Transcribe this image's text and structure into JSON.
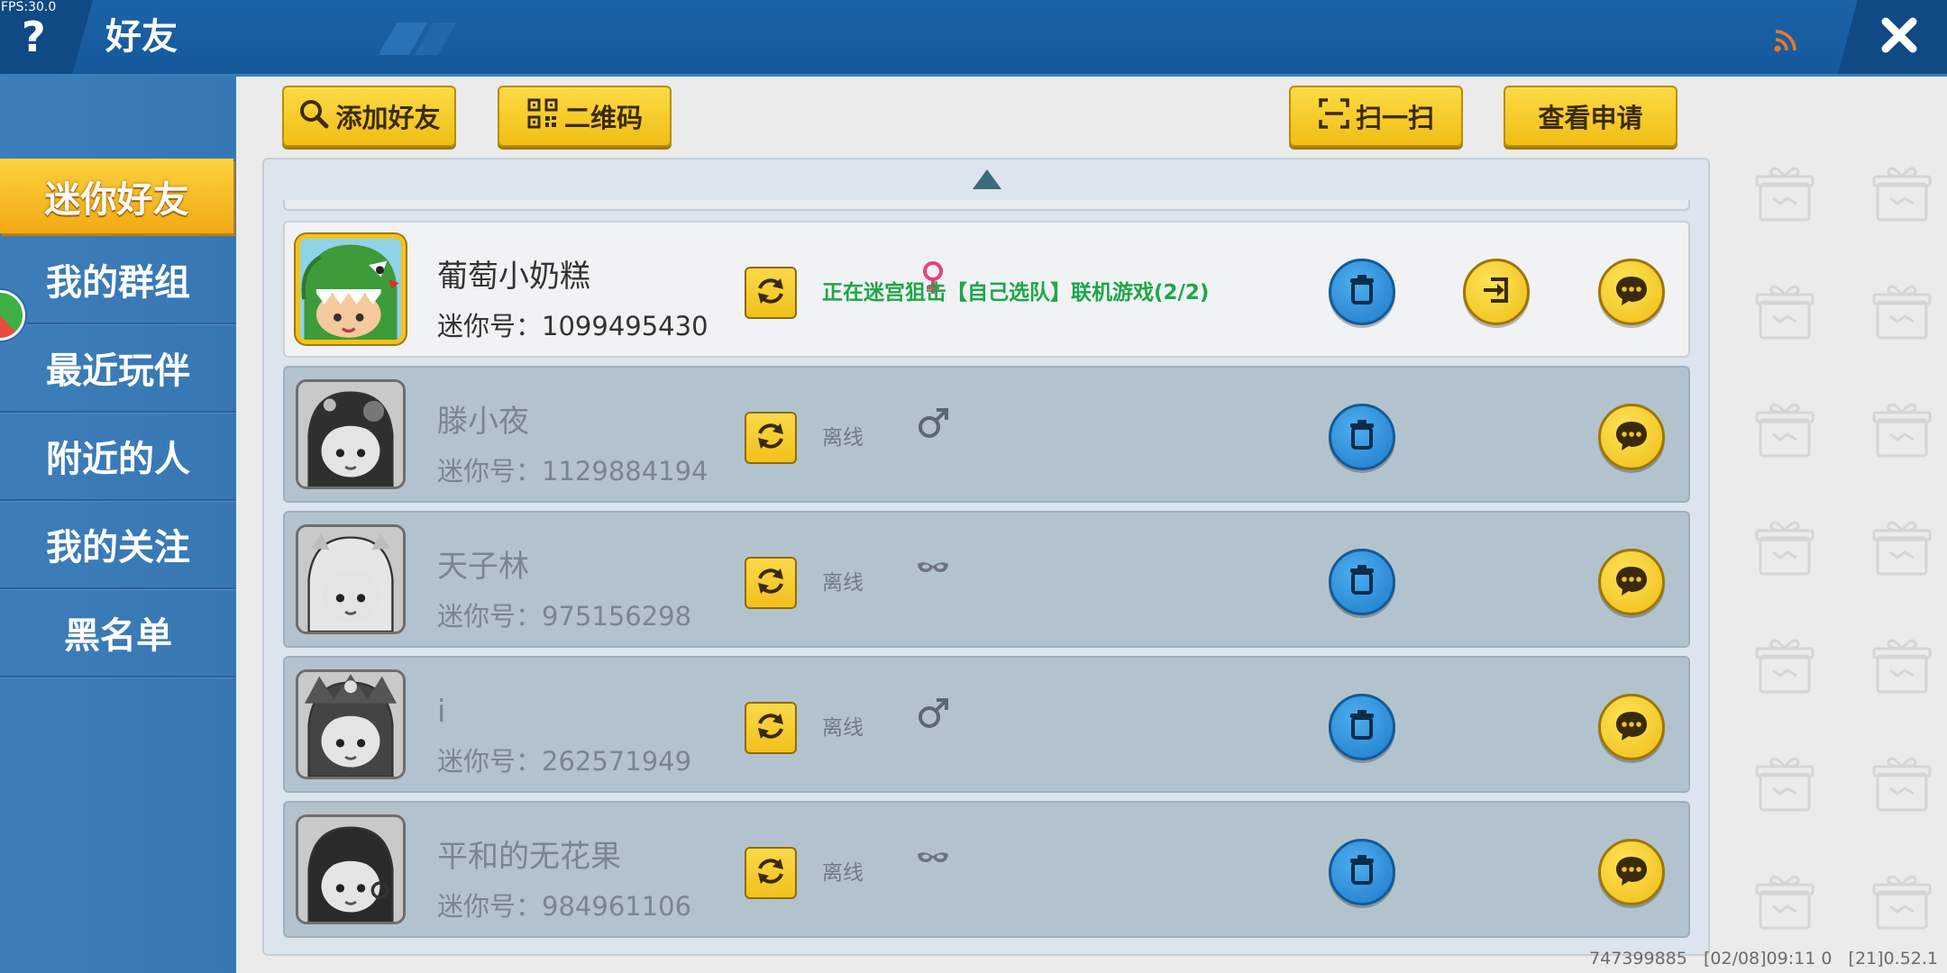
{
  "fps": "FPS:30.0",
  "header": {
    "help_label": "?",
    "title": "好友"
  },
  "sidebar": {
    "items": [
      {
        "label": "迷你好友",
        "selected": true
      },
      {
        "label": "我的群组",
        "selected": false
      },
      {
        "label": "最近玩伴",
        "selected": false
      },
      {
        "label": "附近的人",
        "selected": false
      },
      {
        "label": "我的关注",
        "selected": false
      },
      {
        "label": "黑名单",
        "selected": false
      }
    ]
  },
  "toolbar": {
    "add_friend": "添加好友",
    "qrcode": "二维码",
    "scan": "扫一扫",
    "view_requests": "查看申请"
  },
  "friends": [
    {
      "name": "葡萄小奶糕",
      "gender_icon": "female-icon",
      "id_label": "迷你号：",
      "id": "1099495430",
      "status": "正在迷宫狙击【自己选队】联机游戏(2/2)",
      "online": true,
      "can_join": true
    },
    {
      "name": "滕小夜",
      "gender_icon": "male-icon",
      "id_label": "迷你号：",
      "id": "1129884194",
      "status": "离线",
      "online": false,
      "can_join": false
    },
    {
      "name": "天子林",
      "gender_icon": "mask-icon",
      "id_label": "迷你号：",
      "id": "975156298",
      "status": "离线",
      "online": false,
      "can_join": false
    },
    {
      "name": "i",
      "gender_icon": "male-icon",
      "id_label": "迷你号：",
      "id": "262571949",
      "status": "离线",
      "online": false,
      "can_join": false
    },
    {
      "name": "平和的无花果",
      "gender_icon": "mask-icon",
      "id_label": "迷你号：",
      "id": "984961106",
      "status": "离线",
      "online": false,
      "can_join": false
    }
  ],
  "footer": {
    "version_info": "747399885   [02/08]09:11 0   [21]0.52.1"
  },
  "colors": {
    "header": "#15599a",
    "sidebar": "#3778b4",
    "accent_yellow": "#f6c52a",
    "online_status": "#1ea64a",
    "female": "#e8407e"
  }
}
